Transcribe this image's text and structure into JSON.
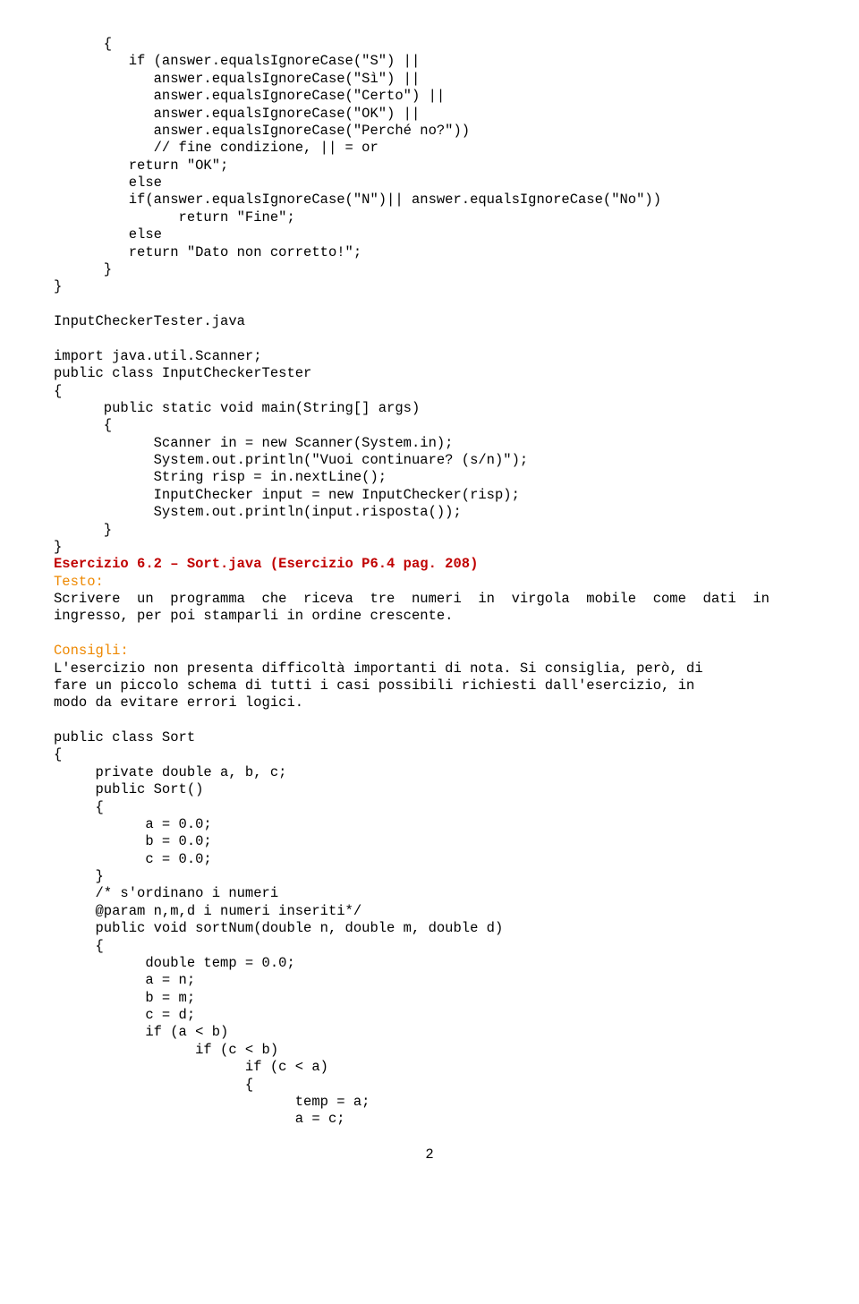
{
  "code1": "      {\n         if (answer.equalsIgnoreCase(\"S\") ||\n            answer.equalsIgnoreCase(\"Sì\") ||\n            answer.equalsIgnoreCase(\"Certo\") ||\n            answer.equalsIgnoreCase(\"OK\") ||\n            answer.equalsIgnoreCase(\"Perché no?\"))\n            // fine condizione, || = or\n         return \"OK\";\n         else\n         if(answer.equalsIgnoreCase(\"N\")|| answer.equalsIgnoreCase(\"No\"))\n               return \"Fine\";\n         else\n         return \"Dato non corretto!\";\n      }\n}\n\nInputCheckerTester.java\n\nimport java.util.Scanner;\npublic class InputCheckerTester\n{\n      public static void main(String[] args)\n      {\n            Scanner in = new Scanner(System.in);\n            System.out.println(\"Vuoi continuare? (s/n)\");\n            String risp = in.nextLine();\n            InputChecker input = new InputChecker(risp);\n            System.out.println(input.risposta());\n      }\n}\n",
  "heading": "Esercizio 6.2 – Sort.java (Esercizio P6.4 pag. 208)",
  "testo_label": "Testo:",
  "testo_body": "Scrivere  un  programma  che  riceva  tre  numeri  in  virgola  mobile  come  dati  in\ningresso, per poi stamparli in ordine crescente.",
  "consigli_label": "Consigli:",
  "consigli_body": "L'esercizio non presenta difficoltà importanti di nota. Si consiglia, però, di\nfare un piccolo schema di tutti i casi possibili richiesti dall'esercizio, in\nmodo da evitare errori logici.",
  "code2": "public class Sort\n{\n     private double a, b, c;\n     public Sort()\n     {\n           a = 0.0;\n           b = 0.0;\n           c = 0.0;\n     }\n     /* s'ordinano i numeri\n     @param n,m,d i numeri inseriti*/\n     public void sortNum(double n, double m, double d)\n     {\n           double temp = 0.0;\n           a = n;\n           b = m;\n           c = d;\n           if (a < b)\n                 if (c < b)\n                       if (c < a)\n                       {\n                             temp = a;\n                             a = c;",
  "page_number": "2"
}
